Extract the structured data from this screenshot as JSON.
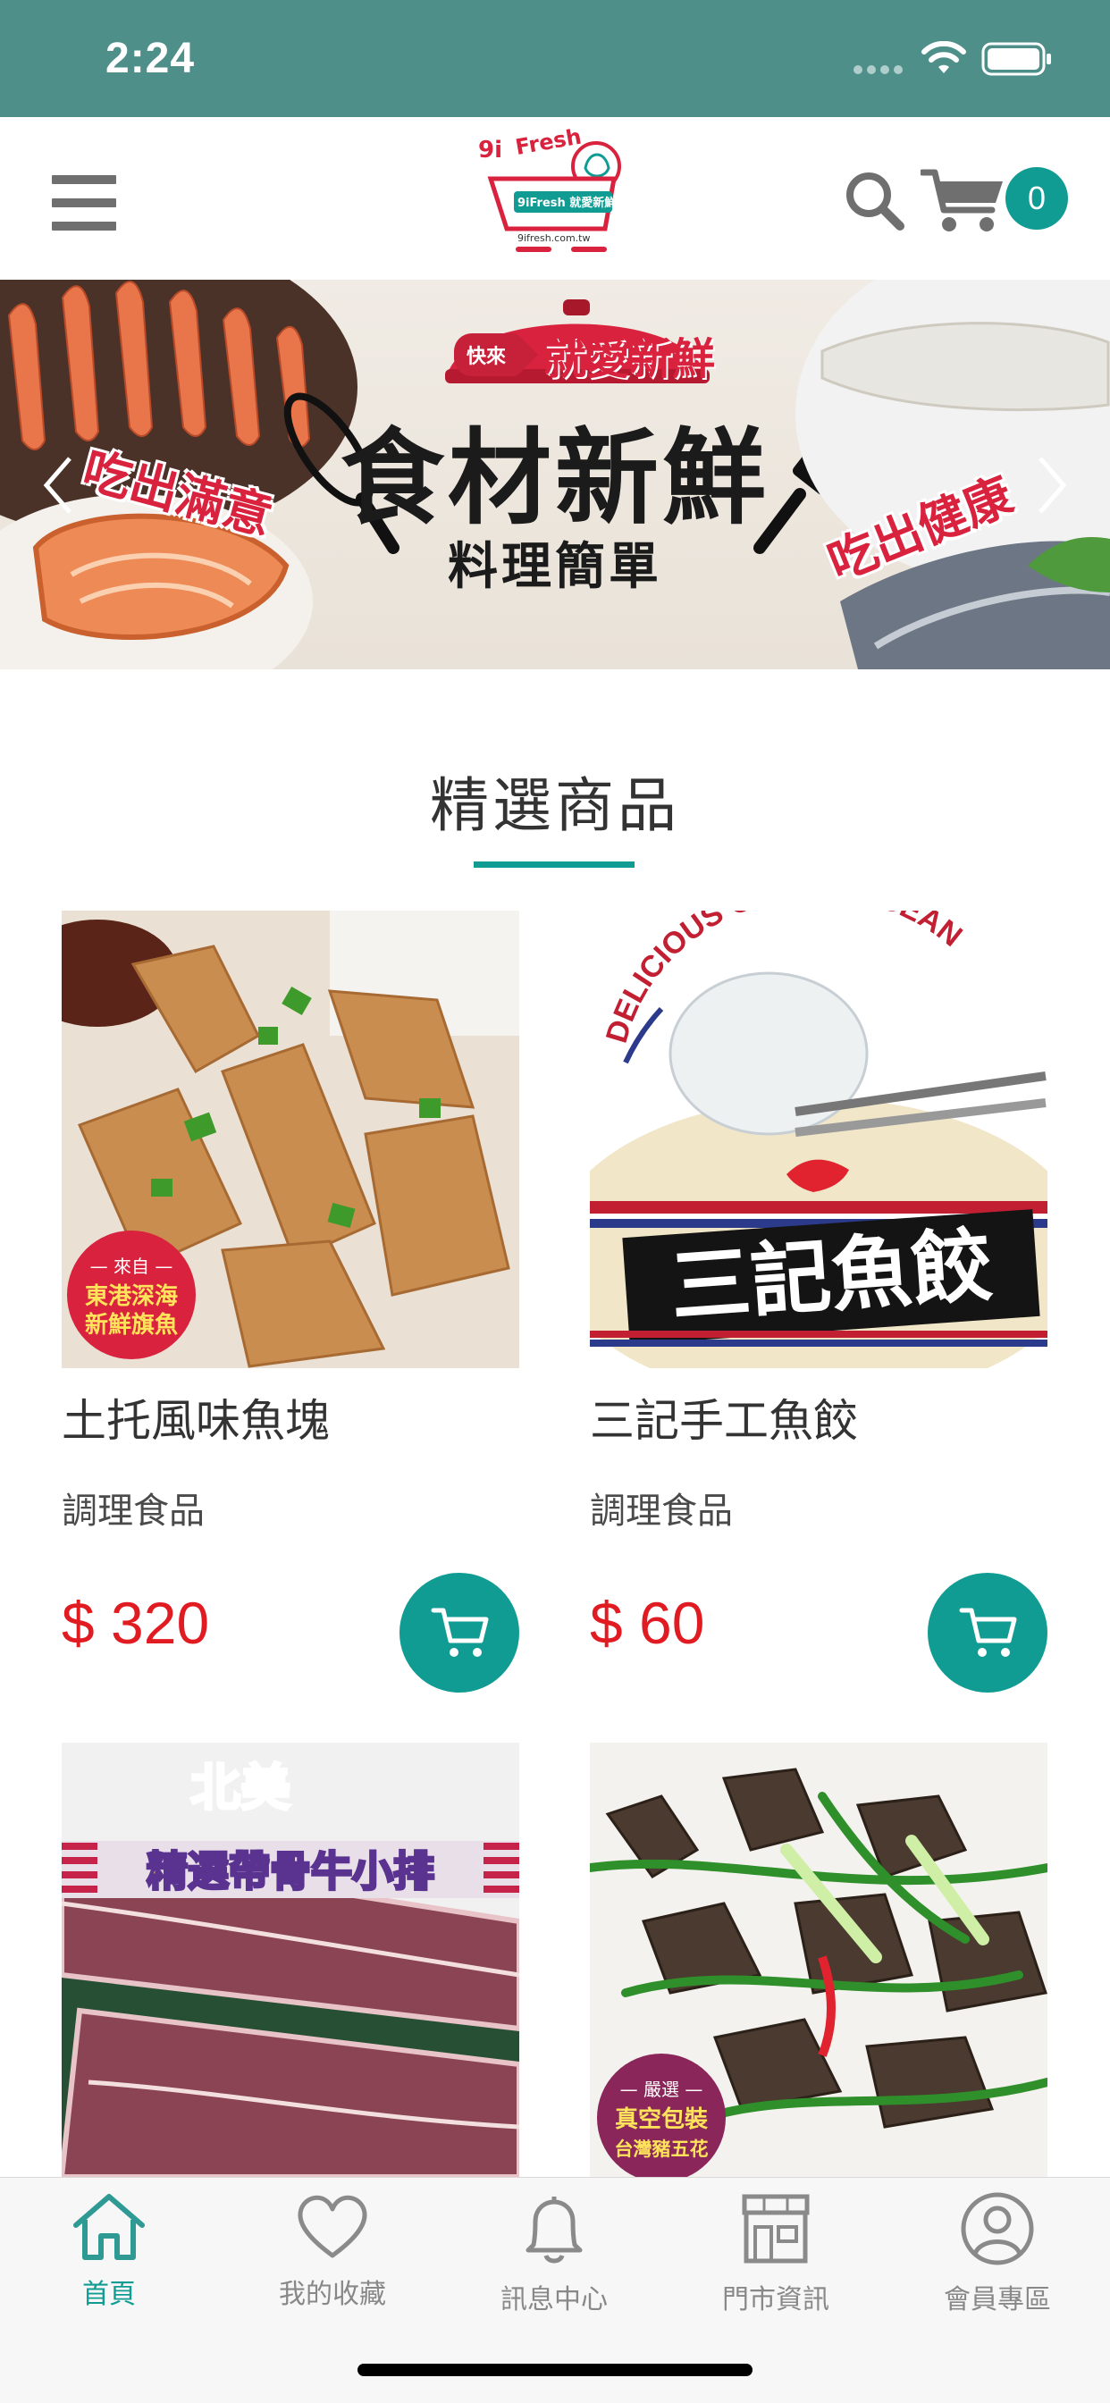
{
  "status_bar": {
    "time": "2:24"
  },
  "header": {
    "logo_text": "9i Fresh",
    "logo_subtitle": "9iFresh 就愛新鮮",
    "logo_url": "9ifresh.com.tw",
    "cart_count": "0"
  },
  "banner": {
    "headline": "食材新鮮",
    "subheadline": "料理簡單",
    "cta_chip": "快來",
    "cta_text": "就愛新鮮",
    "tag_left": "吃出滿意",
    "tag_right": "吃出健康"
  },
  "section": {
    "title": "精選商品"
  },
  "products": [
    {
      "name": "土托風味魚塊",
      "category": "調理食品",
      "price": "$ 320",
      "badge_top": "— 來自 —",
      "badge_line1": "東港深海",
      "badge_line2": "新鮮旗魚"
    },
    {
      "name": "三記手工魚餃",
      "category": "調理食品",
      "price": "$ 60",
      "arc_text": "DELICIOUS OUT OF OCEAN",
      "title_overlay": "三記魚餃"
    },
    {
      "name": "",
      "category": "",
      "price": "",
      "overlay_top": "北美",
      "overlay_banner": "精選帶骨牛小排"
    },
    {
      "name": "",
      "category": "",
      "price": "",
      "badge_top": "— 嚴選 —",
      "badge_line1": "真空包裝",
      "badge_line2": "台灣豬五花"
    }
  ],
  "tabbar": {
    "items": [
      {
        "label": "首頁",
        "icon": "home-icon",
        "active": true
      },
      {
        "label": "我的收藏",
        "icon": "heart-icon",
        "active": false
      },
      {
        "label": "訊息中心",
        "icon": "bell-icon",
        "active": false
      },
      {
        "label": "門市資訊",
        "icon": "store-icon",
        "active": false
      },
      {
        "label": "會員專區",
        "icon": "user-icon",
        "active": false
      }
    ]
  },
  "colors": {
    "status_bar": "#4e9089",
    "accent": "#119c93",
    "price": "#e11b22",
    "brand_red": "#d9223d"
  }
}
